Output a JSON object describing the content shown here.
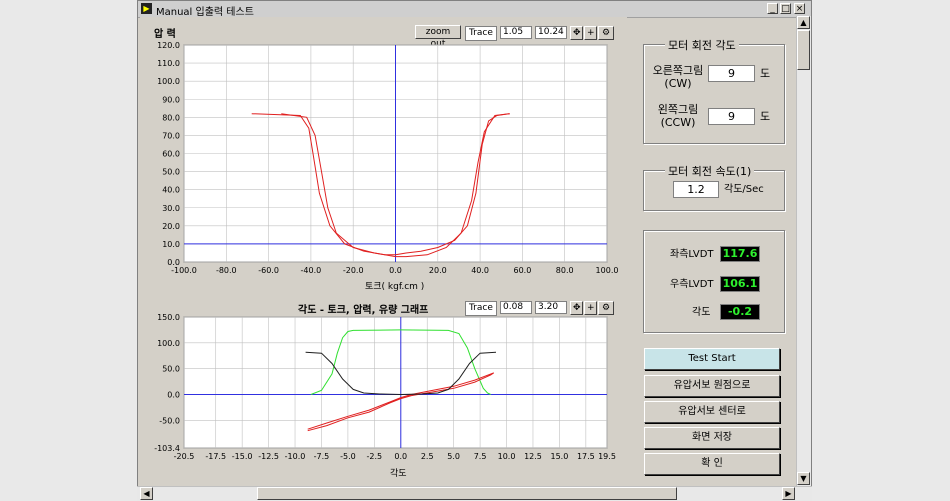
{
  "window": {
    "title": "Manual 입출력 테스트",
    "btn_min": "_",
    "btn_max": "□",
    "btn_close": "×"
  },
  "plot1": {
    "title": "압 력",
    "zoom_label": "zoom out",
    "trace_label": "Trace",
    "trace_val1": "1.05",
    "trace_val2": "10.24",
    "xlabel": "토크( kgf.cm )"
  },
  "plot2": {
    "title": "각도 - 토크, 압력, 유량 그래프",
    "trace_label": "Trace",
    "trace_val1": "0.08",
    "trace_val2": "3.20",
    "xlabel": "각도"
  },
  "motor_angle": {
    "title": "모터 회전 각도",
    "cw_label_1": "오른쪽그림",
    "cw_label_2": "(CW)",
    "cw_value": "9",
    "cw_unit": "도",
    "ccw_label_1": "왼쪽그림",
    "ccw_label_2": "(CCW)",
    "ccw_value": "9",
    "ccw_unit": "도"
  },
  "motor_speed": {
    "title": "모터 회전 속도(1)",
    "value": "1.2",
    "unit": "각도/Sec"
  },
  "readouts": {
    "left_lvdt_label": "좌측LVDT",
    "left_lvdt_value": "117.6",
    "right_lvdt_label": "우측LVDT",
    "right_lvdt_value": "106.1",
    "angle_label": "각도",
    "angle_value": "-0.2"
  },
  "buttons": {
    "test_start": "Test Start",
    "servo_origin": "유압서보 원점으로",
    "servo_center": "유압서보 센터로",
    "save_screen": "화면 저장",
    "confirm": "확    인"
  },
  "colors": {
    "plot_bg": "#ffffff",
    "grid": "#c0c0c0",
    "axis_line": "#3030e0",
    "red": "#e02020",
    "green": "#30e030",
    "black": "#202020",
    "led_text": "#2ef02e"
  },
  "chart_data": [
    {
      "type": "line",
      "title": "압 력",
      "xlabel": "토크( kgf.cm )",
      "ylabel": "",
      "xlim": [
        -100,
        100
      ],
      "ylim": [
        0,
        120
      ],
      "x_ticks": [
        "-100.0",
        "-80.0",
        "-60.0",
        "-40.0",
        "-20.0",
        "0.0",
        "20.0",
        "40.0",
        "60.0",
        "80.0",
        "100.0"
      ],
      "y_ticks": [
        "0.0",
        "10.0",
        "20.0",
        "30.0",
        "40.0",
        "50.0",
        "60.0",
        "70.0",
        "80.0",
        "90.0",
        "100.0",
        "110.0",
        "120.0"
      ],
      "cursor": {
        "x": 0,
        "y": 10
      },
      "series": [
        {
          "color": "#e02020",
          "x": [
            -68,
            -45,
            -41,
            -39,
            -36,
            -31,
            -24,
            -15,
            -5,
            0,
            5,
            12,
            20,
            28,
            34,
            38,
            41,
            44,
            48,
            54
          ],
          "y": [
            82,
            81,
            74,
            60,
            38,
            20,
            10,
            6,
            4,
            4,
            5,
            6,
            8,
            12,
            20,
            38,
            65,
            78,
            81,
            82
          ]
        },
        {
          "color": "#e02020",
          "x": [
            -54,
            -42,
            -38,
            -35,
            -32,
            -28,
            -20,
            -10,
            0,
            5,
            15,
            24,
            31,
            36,
            39,
            42,
            47,
            54
          ],
          "y": [
            82,
            80,
            70,
            50,
            30,
            16,
            8,
            5,
            3,
            3,
            4,
            8,
            16,
            34,
            55,
            72,
            81,
            82
          ]
        }
      ]
    },
    {
      "type": "line",
      "title": "각도 - 토크, 압력, 유량 그래프",
      "xlabel": "각도",
      "ylabel": "",
      "xlim": [
        -20.5,
        19.5
      ],
      "ylim": [
        -103.4,
        150
      ],
      "x_ticks": [
        "-20.5",
        "-17.5",
        "-15.0",
        "-12.5",
        "-10.0",
        "-7.5",
        "-5.0",
        "-2.5",
        "0.0",
        "2.5",
        "5.0",
        "7.5",
        "10.0",
        "12.5",
        "15.0",
        "17.5",
        "19.5"
      ],
      "y_ticks": [
        "-103.4",
        "-50.0",
        "0.0",
        "50.0",
        "100.0",
        "150.0"
      ],
      "cursor": {
        "x": 0,
        "y": 0
      },
      "series": [
        {
          "color": "#30e030",
          "x": [
            -8.5,
            -7.5,
            -6.5,
            -6.0,
            -5.5,
            -5.0,
            -4.5,
            0,
            4.5,
            5.5,
            6.3,
            7.0,
            7.8,
            8.2,
            8.5
          ],
          "y": [
            0,
            8,
            40,
            80,
            110,
            122,
            124,
            125,
            124,
            118,
            90,
            50,
            12,
            3,
            0
          ]
        },
        {
          "color": "#e02020",
          "x": [
            -8.8,
            -7,
            -5,
            -3,
            -1,
            0,
            1,
            3,
            5,
            7,
            8.8,
            8.5,
            7,
            5,
            3,
            1,
            0,
            -1,
            -3,
            -5,
            -7,
            -8.8
          ],
          "y": [
            -67,
            -55,
            -42,
            -30,
            -14,
            -6,
            0,
            8,
            16,
            28,
            42,
            38,
            24,
            12,
            5,
            -2,
            -8,
            -16,
            -34,
            -45,
            -60,
            -70
          ]
        },
        {
          "color": "#202020",
          "x": [
            -9,
            -7.5,
            -6.5,
            -5.5,
            -4.5,
            -3.5,
            -2,
            0,
            2,
            3.5,
            4.5,
            5.5,
            6.5,
            7.5,
            9
          ],
          "y": [
            82,
            80,
            60,
            30,
            10,
            3,
            1,
            0,
            1,
            3,
            10,
            30,
            60,
            80,
            82
          ]
        }
      ]
    }
  ]
}
